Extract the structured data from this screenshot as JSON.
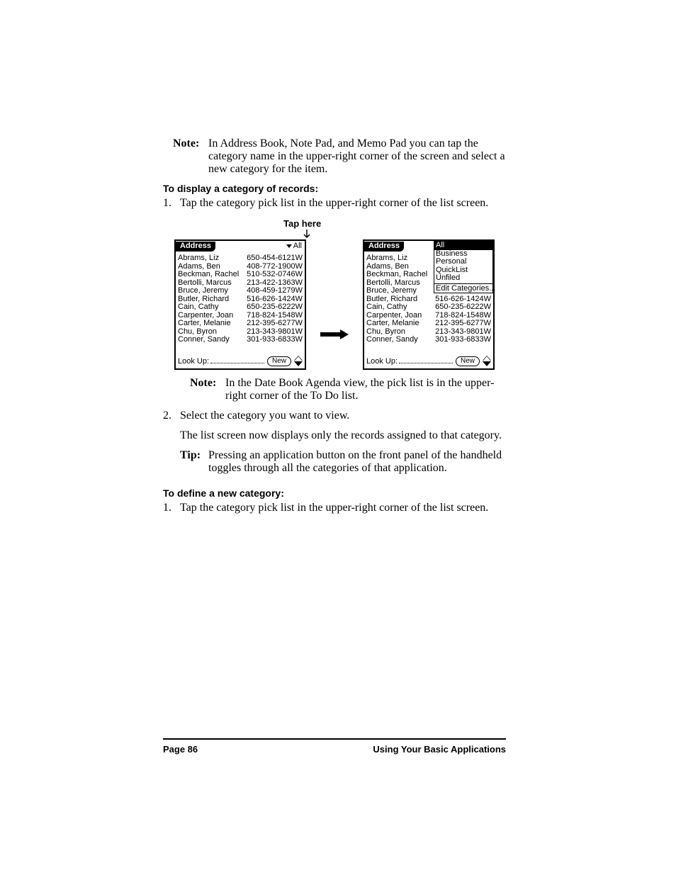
{
  "notes": {
    "label": "Note:",
    "note1": "In Address Book, Note Pad, and Memo Pad you can tap the category name in the upper-right corner of the screen and select a new category for the item.",
    "note2": "In the Date Book Agenda view, the pick list is in the upper-right corner of the To Do list."
  },
  "headings": {
    "h1": "To display a category of records:",
    "h2": "To define a new category:"
  },
  "steps": {
    "s1num": "1.",
    "s1": "Tap the category pick list in the upper-right corner of the list screen.",
    "s2num": "2.",
    "s2a": "Select the category you want to view.",
    "s2b": "The list screen now displays only the records assigned to that category.",
    "s3num": "1.",
    "s3": "Tap the category pick list in the upper-right corner of the list screen."
  },
  "tip": {
    "label": "Tip:",
    "text": "Pressing an application button on the front panel of the handheld toggles through all the categories of that application."
  },
  "figure": {
    "tap_label": "Tap here",
    "app_title": "Address",
    "category_all": "All",
    "lookup_label": "Look Up:",
    "new_label": "New",
    "dropdown": {
      "all": "All",
      "business": "Business",
      "personal": "Personal",
      "quicklist": "QuickList",
      "unfiled": "Unfiled",
      "edit": "Edit Categories..."
    },
    "contacts_full": [
      {
        "name": "Abrams, Liz",
        "phone": "650-454-6121W"
      },
      {
        "name": "Adams, Ben",
        "phone": "408-772-1900W"
      },
      {
        "name": "Beckman, Rachel",
        "phone": "510-532-0746W"
      },
      {
        "name": "Bertolli, Marcus",
        "phone": "213-422-1363W"
      },
      {
        "name": "Bruce, Jeremy",
        "phone": "408-459-1279W"
      },
      {
        "name": "Butler, Richard",
        "phone": "516-626-1424W"
      },
      {
        "name": "Cain, Cathy",
        "phone": "650-235-6222W"
      },
      {
        "name": "Carpenter, Joan",
        "phone": "718-824-1548W"
      },
      {
        "name": "Carter, Melanie",
        "phone": "212-395-6277W"
      },
      {
        "name": "Chu, Byron",
        "phone": "213-343-9801W"
      },
      {
        "name": "Conner, Sandy",
        "phone": "301-933-6833W"
      }
    ]
  },
  "footer": {
    "page": "Page 86",
    "section": "Using Your Basic Applications"
  }
}
